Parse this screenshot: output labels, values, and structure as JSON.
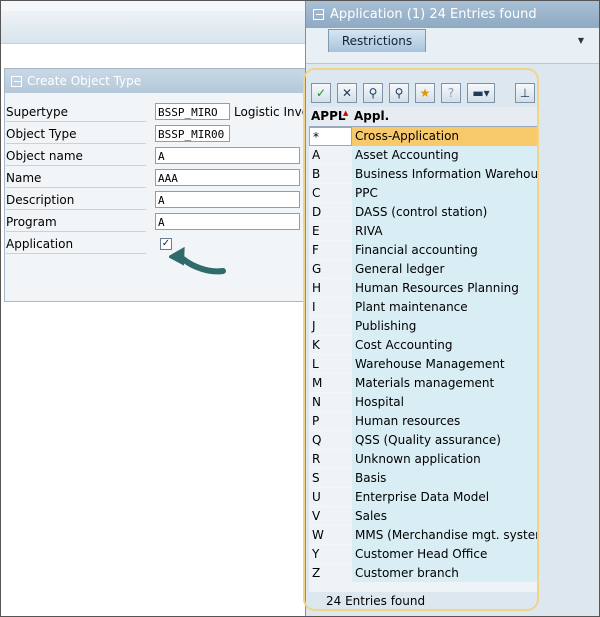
{
  "left_form": {
    "title": "Create Object Type",
    "rows": [
      {
        "label": "Supertype",
        "value": "BSSP_MIRO",
        "extra": "Logistic Invoi"
      },
      {
        "label": "Object Type",
        "value": "BSSP_MIR00",
        "extra": ""
      },
      {
        "label": "Object name",
        "value": "A",
        "extra": ""
      },
      {
        "label": "Name",
        "value": "AAA",
        "extra": ""
      },
      {
        "label": "Description",
        "value": "A",
        "extra": ""
      },
      {
        "label": "Program",
        "value": "A",
        "extra": ""
      }
    ],
    "application_label": "Application",
    "application_checkbox": "✓"
  },
  "popup": {
    "title": "Application (1)   24 Entries found",
    "tab": "Restrictions",
    "toolbar_icons": [
      "checkmark-icon",
      "close-icon",
      "find-icon",
      "find-next-icon",
      "favorites-icon",
      "info-icon",
      "print-icon",
      "pin-icon"
    ],
    "columns": [
      "APPL",
      "Appl."
    ],
    "rows": [
      [
        "*",
        "Cross-Application"
      ],
      [
        "A",
        "Asset Accounting"
      ],
      [
        "B",
        "Business Information Warehouse"
      ],
      [
        "C",
        "PPC"
      ],
      [
        "D",
        "DASS (control station)"
      ],
      [
        "E",
        "RIVA"
      ],
      [
        "F",
        "Financial accounting"
      ],
      [
        "G",
        "General ledger"
      ],
      [
        "H",
        "Human Resources Planning"
      ],
      [
        "I",
        "Plant maintenance"
      ],
      [
        "J",
        "Publishing"
      ],
      [
        "K",
        "Cost Accounting"
      ],
      [
        "L",
        "Warehouse Management"
      ],
      [
        "M",
        "Materials management"
      ],
      [
        "N",
        "Hospital"
      ],
      [
        "P",
        "Human resources"
      ],
      [
        "Q",
        "QSS (Quality assurance)"
      ],
      [
        "R",
        "Unknown application"
      ],
      [
        "S",
        "Basis"
      ],
      [
        "U",
        "Enterprise Data Model"
      ],
      [
        "V",
        "Sales"
      ],
      [
        "W",
        "MMS (Merchandise mgt. system)"
      ],
      [
        "Y",
        "Customer Head Office"
      ],
      [
        "Z",
        "Customer branch"
      ]
    ],
    "selected_index": 0,
    "status": "24 Entries found"
  },
  "colors": {
    "highlight": "#f2d488",
    "selection": "#f7c96b",
    "arrow": "#2f6b6b"
  }
}
